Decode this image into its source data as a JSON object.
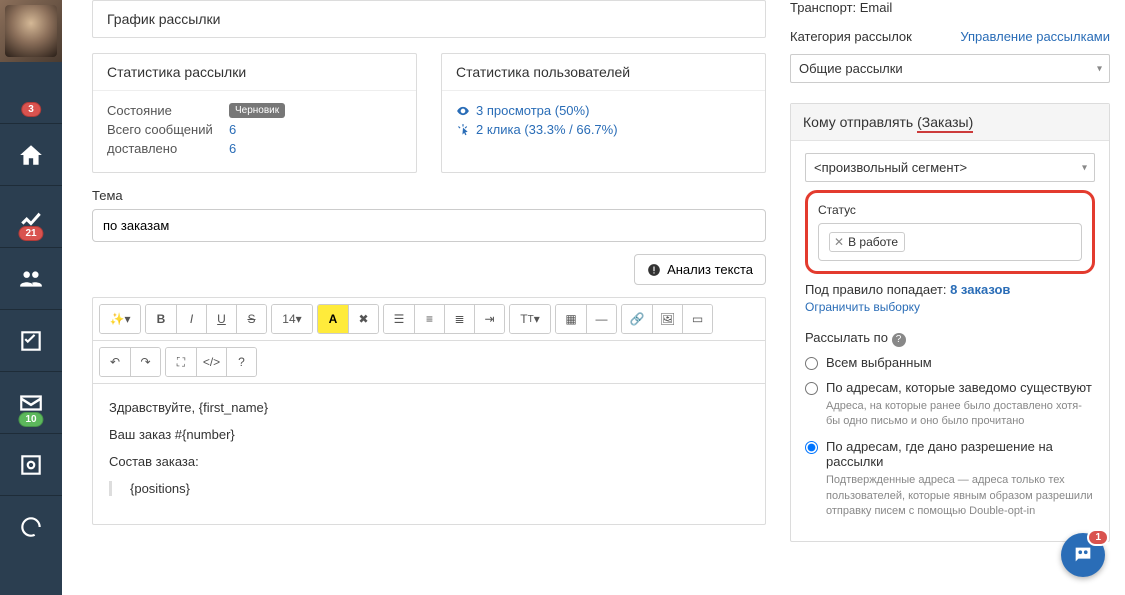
{
  "sidebar": {
    "badge_top": "3",
    "badge_chart": "21",
    "badge_mail": "10"
  },
  "left": {
    "schedule_title": "График рассылки",
    "stats_title": "Статистика рассылки",
    "stats_state_label": "Состояние",
    "stats_state_value": "Черновик",
    "stats_total_label": "Всего сообщений",
    "stats_total_value": "6",
    "stats_delivered_label": "доставлено",
    "stats_delivered_value": "6",
    "userstats_title": "Статистика пользователей",
    "userstats_views": "3 просмотра (50%)",
    "userstats_clicks": "2 клика (33.3% / 66.7%)",
    "subject_label": "Тема",
    "subject_value": "по заказам",
    "analyze_btn": "Анализ текста",
    "body_hello": "Здравствуйте, {first_name}",
    "body_order": "Ваш заказ #{number}",
    "body_contents": "Состав заказа:",
    "body_positions": "{positions}",
    "tb_font_size": "14"
  },
  "right": {
    "transport_label": "Транспорт:",
    "transport_value": "Email",
    "category_label": "Категория рассылок",
    "manage_link": "Управление рассылками",
    "category_value": "Общие рассылки",
    "recipients_label": "Кому отправлять",
    "recipients_hl": "(Заказы)",
    "segment_value": "<произвольный сегмент>",
    "status_label": "Статус",
    "status_tag": "В работе",
    "rule_prefix": "Под правило попадает:",
    "rule_count": "8 заказов",
    "limit_link": "Ограничить выборку",
    "sendby_label": "Рассылать по",
    "r1": "Всем выбранным",
    "r2": "По адресам, которые заведомо существуют",
    "r2_desc": "Адреса, на которые ранее было доставлено хотя-бы одно письмо и оно было прочитано",
    "r3": "По адресам, где дано разрешение на рассылки",
    "r3_desc": "Подтвержденные адреса — адреса только тех пользователей, которые явным образом разрешили отправку писем с помощью Double-opt-in"
  },
  "fab_badge": "1"
}
